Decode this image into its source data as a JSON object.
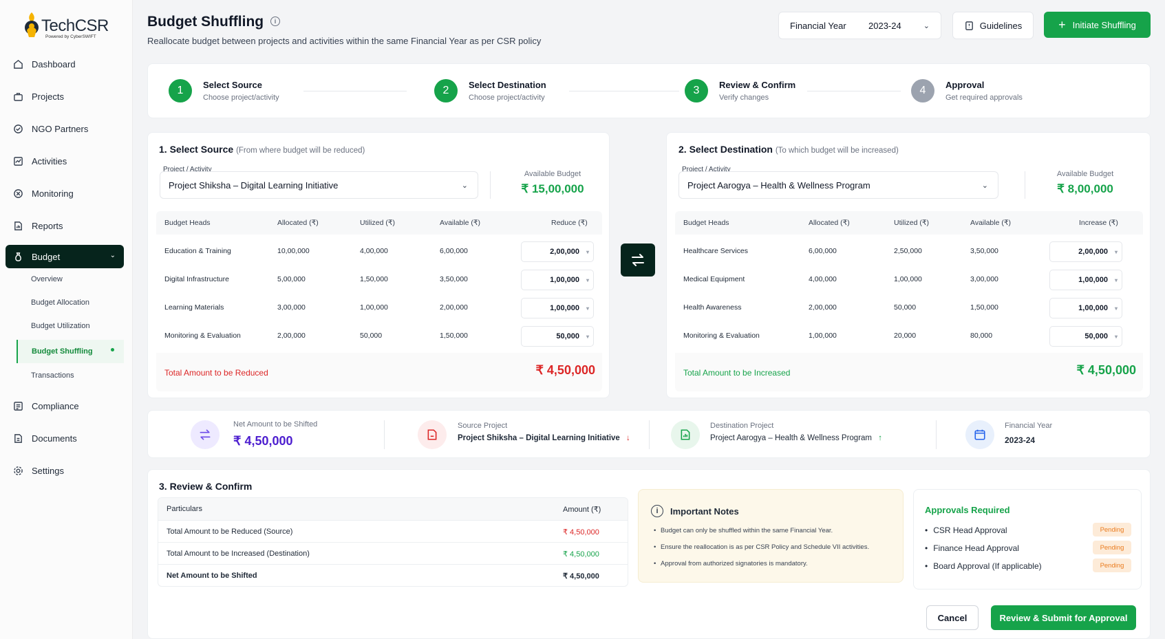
{
  "app": {
    "logo_text": "TechCSR",
    "logo_sub": "Powered by CyberSWIFT"
  },
  "sidebar": {
    "items": [
      {
        "label": "Dashboard",
        "icon": "home-icon"
      },
      {
        "label": "Projects",
        "icon": "briefcase-icon"
      },
      {
        "label": "NGO Partners",
        "icon": "handshake-icon"
      },
      {
        "label": "Activities",
        "icon": "activity-icon"
      },
      {
        "label": "Monitoring",
        "icon": "target-icon"
      },
      {
        "label": "Reports",
        "icon": "report-icon"
      },
      {
        "label": "Budget",
        "icon": "money-bag-icon"
      },
      {
        "label": "Compliance",
        "icon": "checklist-icon"
      },
      {
        "label": "Documents",
        "icon": "document-icon"
      },
      {
        "label": "Settings",
        "icon": "gear-icon"
      }
    ],
    "budget_sub": [
      "Overview",
      "Budget Allocation",
      "Budget Utilization",
      "Budget Shuffling",
      "Transactions"
    ]
  },
  "header": {
    "title": "Budget Shuffling",
    "subtitle": "Reallocate budget between projects and activities within the same Financial Year as per CSR policy",
    "fy_label": "Financial Year",
    "fy_value": "2023-24",
    "guidelines": "Guidelines",
    "initiate": "Initiate Shuffling"
  },
  "steps": [
    {
      "num": "1",
      "title": "Select Source",
      "sub": "Choose project/activity"
    },
    {
      "num": "2",
      "title": "Select Destination",
      "sub": "Choose project/activity"
    },
    {
      "num": "3",
      "title": "Review & Confirm",
      "sub": "Verify changes"
    },
    {
      "num": "4",
      "title": "Approval",
      "sub": "Get required approvals"
    }
  ],
  "source": {
    "title": "1. Select Source",
    "hint": "(From where budget will be reduced)",
    "field_label": "Project / Activity",
    "project": "Project Shiksha – Digital Learning Initiative",
    "avail_label": "Available Budget",
    "avail_value": "₹ 15,00,000",
    "headers": [
      "Budget Heads",
      "Allocated (₹)",
      "Utilized (₹)",
      "Available (₹)",
      "Reduce (₹)"
    ],
    "rows": [
      [
        "Education & Training",
        "10,00,000",
        "4,00,000",
        "6,00,000",
        "2,00,000"
      ],
      [
        "Digital Infrastructure",
        "5,00,000",
        "1,50,000",
        "3,50,000",
        "1,00,000"
      ],
      [
        "Learning Materials",
        "3,00,000",
        "1,00,000",
        "2,00,000",
        "1,00,000"
      ],
      [
        "Monitoring & Evaluation",
        "2,00,000",
        "50,000",
        "1,50,000",
        "50,000"
      ]
    ],
    "total_label": "Total Amount to be Reduced",
    "total_value": "₹ 4,50,000"
  },
  "destination": {
    "title": "2. Select Destination",
    "hint": "(To which budget will be increased)",
    "field_label": "Project / Activity",
    "project": "Project Aarogya – Health & Wellness Program",
    "avail_label": "Available Budget",
    "avail_value": "₹ 8,00,000",
    "headers": [
      "Budget Heads",
      "Allocated (₹)",
      "Utilized (₹)",
      "Available (₹)",
      "Increase (₹)"
    ],
    "rows": [
      [
        "Healthcare Services",
        "6,00,000",
        "2,50,000",
        "3,50,000",
        "2,00,000"
      ],
      [
        "Medical Equipment",
        "4,00,000",
        "1,00,000",
        "3,00,000",
        "1,00,000"
      ],
      [
        "Health Awareness",
        "2,00,000",
        "50,000",
        "1,50,000",
        "1,00,000"
      ],
      [
        "Monitoring & Evaluation",
        "1,00,000",
        "20,000",
        "80,000",
        "50,000"
      ]
    ],
    "total_label": "Total Amount to be Increased",
    "total_value": "₹ 4,50,000"
  },
  "summary": {
    "net_label": "Net Amount to be Shifted",
    "net_value": "₹ 4,50,000",
    "src_label": "Source Project",
    "src_value": "Project Shiksha – Digital Learning Initiative",
    "dst_label": "Destination Project",
    "dst_value": "Project Aarogya – Health & Wellness Program",
    "fy_label": "Financial Year",
    "fy_value": "2023-24"
  },
  "review": {
    "title": "3. Review & Confirm",
    "col1": "Particulars",
    "col2": "Amount (₹)",
    "rows": [
      [
        "Total Amount to be Reduced (Source)",
        "₹ 4,50,000"
      ],
      [
        "Total Amount to be Increased (Destination)",
        "₹ 4,50,000"
      ],
      [
        "Net Amount to be Shifted",
        "₹ 4,50,000"
      ]
    ],
    "notes_title": "Important Notes",
    "notes": [
      "Budget can only be shuffled within the same Financial Year.",
      "Ensure the reallocation is as per CSR Policy and Schedule VII activities.",
      "Approval from authorized signatories is mandatory."
    ],
    "approvals_title": "Approvals Required",
    "approvals": [
      {
        "label": "CSR Head Approval",
        "status": "Pending"
      },
      {
        "label": "Finance Head Approval",
        "status": "Pending"
      },
      {
        "label": "Board Approval (If applicable)",
        "status": "Pending"
      }
    ]
  },
  "actions": {
    "cancel": "Cancel",
    "submit": "Review & Submit for Approval"
  },
  "colors": {
    "accent": "#16a34a",
    "dark": "#06241c",
    "danger": "#dc2626",
    "pending": "#ea7c1f"
  }
}
